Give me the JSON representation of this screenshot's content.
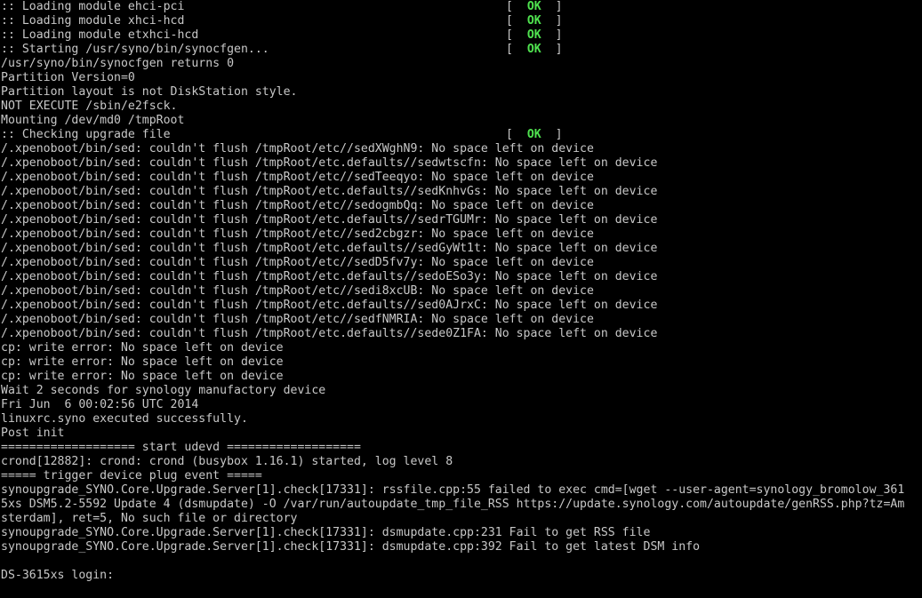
{
  "colors": {
    "background": "#000000",
    "text": "#c8c8c8",
    "ok": "#4fe24f"
  },
  "console": {
    "lines": [
      ":: Loading module ehci-pci",
      ":: Loading module xhci-hcd",
      ":: Loading module etxhci-hcd",
      ":: Starting /usr/syno/bin/synocfgen...",
      "/usr/syno/bin/synocfgen returns 0",
      "Partition Version=0",
      "Partition layout is not DiskStation style.",
      "NOT EXECUTE /sbin/e2fsck.",
      "Mounting /dev/md0 /tmpRoot",
      ":: Checking upgrade file",
      "/.xpenoboot/bin/sed: couldn't flush /tmpRoot/etc//sedXWghN9: No space left on device",
      "/.xpenoboot/bin/sed: couldn't flush /tmpRoot/etc.defaults//sedwtscfn: No space left on device",
      "/.xpenoboot/bin/sed: couldn't flush /tmpRoot/etc//sedTeeqyo: No space left on device",
      "/.xpenoboot/bin/sed: couldn't flush /tmpRoot/etc.defaults//sedKnhvGs: No space left on device",
      "/.xpenoboot/bin/sed: couldn't flush /tmpRoot/etc//sedogmbQq: No space left on device",
      "/.xpenoboot/bin/sed: couldn't flush /tmpRoot/etc.defaults//sedrTGUMr: No space left on device",
      "/.xpenoboot/bin/sed: couldn't flush /tmpRoot/etc//sed2cbgzr: No space left on device",
      "/.xpenoboot/bin/sed: couldn't flush /tmpRoot/etc.defaults//sedGyWt1t: No space left on device",
      "/.xpenoboot/bin/sed: couldn't flush /tmpRoot/etc//sedD5fv7y: No space left on device",
      "/.xpenoboot/bin/sed: couldn't flush /tmpRoot/etc.defaults//sedoESo3y: No space left on device",
      "/.xpenoboot/bin/sed: couldn't flush /tmpRoot/etc//sedi8xcUB: No space left on device",
      "/.xpenoboot/bin/sed: couldn't flush /tmpRoot/etc.defaults//sed0AJrxC: No space left on device",
      "/.xpenoboot/bin/sed: couldn't flush /tmpRoot/etc//sedfNMRIA: No space left on device",
      "/.xpenoboot/bin/sed: couldn't flush /tmpRoot/etc.defaults//sede0Z1FA: No space left on device",
      "cp: write error: No space left on device",
      "cp: write error: No space left on device",
      "cp: write error: No space left on device",
      "Wait 2 seconds for synology manufactory device",
      "Fri Jun  6 00:02:56 UTC 2014",
      "linuxrc.syno executed successfully.",
      "Post init",
      "=================== start udevd ===================",
      "crond[12882]: crond: crond (busybox 1.16.1) started, log level 8",
      "===== trigger device plug event =====",
      "synoupgrade_SYNO.Core.Upgrade.Server[1].check[17331]: rssfile.cpp:55 failed to exec cmd=[wget --user-agent=synology_bromolow_361",
      "5xs DSM5.2-5592 Update 4 (dsmupdate) -O /var/run/autoupdate_tmp_file_RSS https://update.synology.com/autoupdate/genRSS.php?tz=Am",
      "sterdam], ret=5, No such file or directory",
      "synoupgrade_SYNO.Core.Upgrade.Server[1].check[17331]: dsmupdate.cpp:231 Fail to get RSS file",
      "synoupgrade_SYNO.Core.Upgrade.Server[1].check[17331]: dsmupdate.cpp:392 Fail to get latest DSM info",
      "",
      "DS-3615xs login: "
    ],
    "status": {
      "open": "[",
      "ok": "OK",
      "close": "]"
    },
    "status_lines": [
      0,
      1,
      2,
      3,
      9
    ]
  }
}
